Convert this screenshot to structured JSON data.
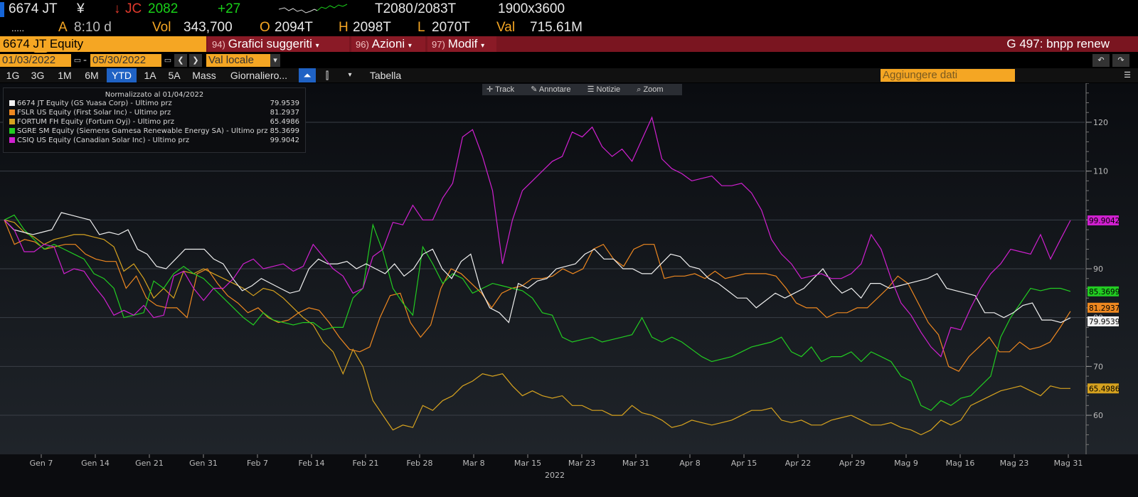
{
  "ticker": {
    "symbol": "6674 JT",
    "currency": "¥",
    "exchange": "JC",
    "last": "2082",
    "change": "+27",
    "bid": "T2080",
    "ask": "/2083T",
    "size": "1900x3600",
    "dots": ".....",
    "time_prefix": "A",
    "time": "8:10 d",
    "vol_label": "Vol",
    "vol": "343,700",
    "open_label": "O",
    "open": "2094T",
    "high_label": "H",
    "high": "2098T",
    "low_label": "L",
    "low": "2070T",
    "val_label": "Val",
    "val": "715.61M"
  },
  "commandbar": {
    "security": "6674 JT Equity",
    "menus": [
      {
        "num": "94)",
        "label": "Grafici suggeriti"
      },
      {
        "num": "96)",
        "label": "Azioni"
      },
      {
        "num": "97)",
        "label": "Modif"
      }
    ],
    "gfunction": "G 497: bnpp renew"
  },
  "daterange": {
    "start": "01/03/2022",
    "sep": "-",
    "end": "05/30/2022",
    "currency_mode": "Val locale"
  },
  "periods": [
    "1G",
    "3G",
    "1M",
    "6M",
    "YTD",
    "1A",
    "5A",
    "Mass",
    "Giornaliero..."
  ],
  "active_period": "YTD",
  "table_label": "Tabella",
  "add_data_placeholder": "Aggiungere dati",
  "toolbar": [
    "Track",
    "Annotare",
    "Notizie",
    "Zoom"
  ],
  "colors": {
    "accent": "#f5a623",
    "command_bar": "#7a1520",
    "active": "#1f62c4"
  },
  "chart_data": {
    "type": "line",
    "title": "Normalizzato al 01/04/2022",
    "x_labels": [
      "Gen 7",
      "Gen 14",
      "Gen 21",
      "Gen 31",
      "Feb 7",
      "Feb 14",
      "Feb 21",
      "Feb 28",
      "Mar 8",
      "Mar 15",
      "Mar 23",
      "Mar 31",
      "Apr 8",
      "Apr 15",
      "Apr 22",
      "Apr 29",
      "Mag 9",
      "Mag 16",
      "Mag 23",
      "Mag 31"
    ],
    "x_year": "2022",
    "ylim": [
      52,
      128
    ],
    "y_ticks": [
      60,
      70,
      80,
      90,
      100,
      110,
      120
    ],
    "grid": true,
    "series": [
      {
        "name": "6674 JT Equity (GS Yuasa Corp) - Ultimo prz",
        "color": "#f0f0f0",
        "last": "79.9539",
        "values": [
          100,
          98,
          97.5,
          97,
          97.5,
          98,
          101.5,
          101,
          100.5,
          100,
          97,
          97.5,
          97,
          98,
          94,
          93,
          90.5,
          90,
          92,
          94,
          94,
          94,
          92,
          91,
          88,
          85.5,
          86.5,
          88,
          87,
          86,
          85,
          85.5,
          90,
          92,
          91,
          91,
          91.5,
          90,
          91,
          90,
          89,
          91,
          88.5,
          90,
          93,
          94,
          90,
          88,
          91.5,
          93,
          86,
          82,
          81,
          79,
          87,
          86,
          87.5,
          88,
          90,
          90.5,
          91,
          93,
          94,
          92,
          92,
          90,
          90,
          89,
          89,
          91,
          93,
          92.5,
          90.5,
          90,
          88,
          87,
          85.5,
          84,
          84,
          82,
          83.5,
          85,
          84,
          85,
          86,
          88,
          90,
          87,
          85,
          86,
          84,
          87,
          87,
          86,
          86.5,
          87,
          87.5,
          88,
          89,
          86,
          85.5,
          85,
          84.5,
          81,
          81,
          80,
          81,
          82.5,
          83,
          79.5,
          79.5,
          79,
          79.9539
        ]
      },
      {
        "name": "FSLR US Equity (First Solar Inc) - Ultimo prz",
        "color": "#ee8820",
        "last": "81.2937",
        "values": [
          100,
          95,
          96,
          95.5,
          94,
          94.5,
          95,
          95,
          93,
          92,
          91.5,
          91.5,
          86,
          88.5,
          84,
          82.5,
          82,
          82,
          80,
          89,
          90,
          87,
          84.5,
          83,
          81,
          82,
          80,
          79,
          79.5,
          81,
          82,
          81.5,
          79,
          76,
          73.5,
          73,
          74,
          80,
          84.5,
          85,
          79,
          76,
          78.5,
          86,
          90,
          89,
          87,
          85,
          82,
          85,
          86,
          86.5,
          88,
          88,
          88.5,
          90,
          89,
          90,
          94,
          95,
          92,
          90.5,
          94,
          95,
          95,
          88,
          88.5,
          88.5,
          89,
          88,
          89.5,
          88,
          88.5,
          89,
          89,
          89,
          88.5,
          86,
          83,
          82,
          82,
          80,
          81,
          81,
          82,
          82,
          84,
          86,
          88.5,
          87,
          83,
          79,
          76.5,
          70,
          69,
          72,
          74,
          76,
          73,
          73,
          75,
          73.5,
          74,
          75,
          78,
          81.2937
        ]
      },
      {
        "name": "FORTUM FH Equity (Fortum Oyj) - Ultimo prz",
        "color": "#d6a21f",
        "last": "65.4986",
        "values": [
          100,
          99.5,
          97.5,
          96.5,
          95,
          96,
          96.5,
          97,
          97,
          96.5,
          96,
          94.5,
          89.5,
          91,
          88,
          84,
          86,
          84,
          89.5,
          89,
          90,
          89,
          88,
          87,
          86,
          84.5,
          86,
          85.5,
          84,
          82,
          80,
          78.5,
          75,
          73,
          68.5,
          73.5,
          70,
          63,
          60,
          57,
          58,
          57.5,
          62,
          61,
          63,
          64,
          66,
          67,
          68.5,
          68,
          68.5,
          66,
          64,
          65,
          64,
          63.5,
          64,
          62,
          62,
          61,
          61,
          60,
          60,
          62,
          60.5,
          60,
          59,
          57.5,
          58,
          59,
          58.5,
          58,
          58.5,
          59,
          60,
          61,
          61,
          61.5,
          59,
          58.5,
          59,
          58,
          58,
          59,
          59.5,
          60,
          59,
          58,
          58,
          58.5,
          57.5,
          57,
          56,
          57,
          59,
          58,
          59,
          62,
          63,
          64,
          65,
          65.5,
          66,
          65,
          64,
          66,
          65.5,
          65.4986
        ]
      },
      {
        "name": "SGRE SM Equity (Siemens Gamesa Renewable Energy SA) - Ultimo prz",
        "color": "#22cc22",
        "last": "85.3699",
        "values": [
          100,
          101,
          98,
          96,
          94,
          95,
          94,
          93,
          92,
          89,
          88,
          86,
          80,
          80.5,
          81,
          87.5,
          86,
          89,
          90.5,
          89,
          88,
          86,
          84,
          82,
          80,
          78.5,
          81,
          79.5,
          79,
          78.5,
          79,
          79,
          77.5,
          78,
          78,
          84,
          86,
          99,
          93.5,
          86,
          83,
          80.5,
          94.5,
          91,
          87,
          89,
          88,
          85,
          86,
          87,
          86.5,
          86,
          85.5,
          84,
          81,
          80.5,
          76,
          75,
          75.5,
          76,
          75,
          75.5,
          76,
          76.5,
          80,
          76,
          75,
          76,
          75,
          73.5,
          72,
          71,
          71.5,
          72,
          73,
          74,
          74.5,
          75,
          76,
          73,
          72,
          74,
          71,
          72,
          72,
          73,
          71,
          73,
          72,
          71,
          68,
          67,
          62,
          61,
          63,
          62,
          63.5,
          64,
          66,
          68,
          76,
          80,
          83,
          86,
          85.5,
          86,
          86,
          85.3699
        ]
      },
      {
        "name": "CSIQ US Equity (Canadian Solar Inc) - Ultimo prz",
        "color": "#d020d0",
        "last": "99.9042",
        "values": [
          100,
          98,
          93.5,
          93.5,
          95,
          94.5,
          89,
          90,
          89.5,
          86.5,
          84,
          80.5,
          81.5,
          80.5,
          82.5,
          80,
          80.5,
          88.5,
          89.5,
          86,
          83.5,
          86,
          86,
          88,
          91,
          92,
          90,
          90.5,
          91,
          89.5,
          90.5,
          95,
          92.5,
          90,
          88.5,
          85,
          86,
          92.5,
          94,
          99.5,
          99,
          103,
          100,
          100,
          104.5,
          107.5,
          117,
          118.5,
          113,
          106,
          91,
          100,
          106,
          108,
          110,
          112,
          113,
          118,
          117,
          119,
          115,
          113,
          114.5,
          112,
          116.5,
          121,
          112.5,
          110.5,
          109.5,
          108,
          108.5,
          109,
          107,
          107,
          107.5,
          105.5,
          102,
          96,
          93,
          91,
          88,
          88.5,
          89,
          88,
          88,
          89,
          91,
          97,
          94,
          88,
          83,
          80.5,
          77,
          74,
          72,
          78,
          77.5,
          82,
          86,
          89,
          91,
          94,
          93.5,
          93,
          97,
          92,
          96,
          99.9042
        ]
      }
    ]
  }
}
